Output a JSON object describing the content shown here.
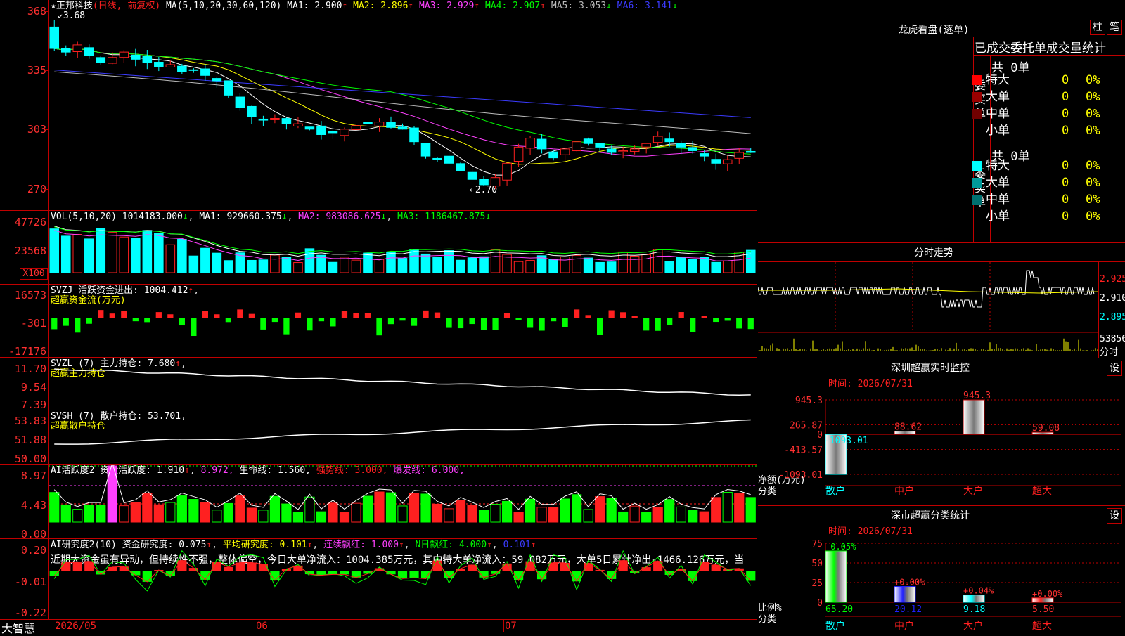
{
  "stock": {
    "name": "正邦科技",
    "mode": "(日线, 前复权)",
    "ma_label": "MA(5,10,20,30,60,120)",
    "ma": [
      {
        "label": "MA1:",
        "value": "2.900",
        "color": "#ffffff"
      },
      {
        "label": "MA2:",
        "value": "2.896",
        "color": "#ffff00"
      },
      {
        "label": "MA3:",
        "value": "2.929",
        "color": "#ff40ff"
      },
      {
        "label": "MA4:",
        "value": "2.907",
        "color": "#00ff00"
      },
      {
        "label": "MA5:",
        "value": "3.053",
        "color": "#bbbbbb"
      },
      {
        "label": "MA6:",
        "value": "3.141",
        "color": "#3b3bff"
      }
    ],
    "high_marker": "3.68",
    "low_marker": "2.70"
  },
  "price_axis": [
    "368",
    "335",
    "303",
    "270"
  ],
  "vol": {
    "label": "VOL(5,10,20)",
    "value": "1014183.000",
    "ma1": "MA1: 929660.375",
    "ma2": "MA2: 983086.625",
    "ma3": "MA3: 1186467.875",
    "axis": [
      "47726",
      "23568"
    ],
    "unit": "X100"
  },
  "svzj": {
    "label": "SVZJ  活跃资金进出: 1004.412",
    "sub": "超赢资金流(万元)",
    "axis": [
      "16573",
      "-301",
      "-17176"
    ]
  },
  "svzl": {
    "label": "SVZL (7) 主力持仓: 7.680",
    "sub": "超赢主力持仓",
    "axis": [
      "11.70",
      "9.54",
      "7.39"
    ]
  },
  "svsh": {
    "label": "SVSH (7) 散户持仓: 53.701",
    "sub": "超赢散户持仓",
    "axis": [
      "53.83",
      "51.88",
      "50.00"
    ]
  },
  "ai_active": {
    "label": "AI活跃度2 资金活跃度: 1.910",
    "v2": "8.972,",
    "life": "生命线: 1.560,",
    "strong": "强势线: 3.000,",
    "burst": "爆发线: 6.000,",
    "axis": [
      "8.97",
      "4.43",
      "0.00"
    ]
  },
  "ai_research": {
    "label": "AI研究度2(10) 资金研究度: 0.075",
    "avg": "平均研究度: 0.101",
    "cont": "连续飘红: 1.000",
    "nday": "N日飘红: 4.000",
    "last": "0.101",
    "comment": "近期大资金虽有异动，但持续性不强，整体偏空，今日大单净流入：1004.385万元，其中特大单净流入：59.082万元，大单5日累计净出-1466.126万元，当",
    "axis": [
      "0.20",
      "-0.01",
      "-0.22"
    ]
  },
  "date_axis": [
    "2026/05",
    "06",
    "07"
  ],
  "logo": "大智慧",
  "dragon": {
    "title": "龙虎看盘(逐单)",
    "btn_zhu": "柱",
    "btn_bi": "笔",
    "header": "已成交委托单成交量统计",
    "buy_total": "共 0单",
    "buy_side": "委买单",
    "sell_total": "共 0单",
    "sell_side": "委卖单",
    "buy_rows": [
      {
        "name": "特大",
        "color": "#ff0000",
        "value": "0",
        "pct": "0%"
      },
      {
        "name": "大单",
        "color": "#9a0000",
        "value": "0",
        "pct": "0%"
      },
      {
        "name": "中单",
        "color": "#700000",
        "value": "0",
        "pct": "0%"
      },
      {
        "name": "小单",
        "color": "#000000",
        "value": "0",
        "pct": "0%"
      }
    ],
    "sell_rows": [
      {
        "name": "特大",
        "color": "#00ffff",
        "value": "0",
        "pct": "0%"
      },
      {
        "name": "大单",
        "color": "#009a9a",
        "value": "0",
        "pct": "0%"
      },
      {
        "name": "中单",
        "color": "#007070",
        "value": "0",
        "pct": "0%"
      },
      {
        "name": "小单",
        "color": "#000000",
        "value": "0",
        "pct": "0%"
      }
    ]
  },
  "intraday": {
    "title": "分时走势",
    "p1": "2.925",
    "p2": "2.910",
    "p3": "2.895",
    "vol": "53856",
    "unit": "分时"
  },
  "monitor": {
    "title": "深圳超赢实时监控",
    "btn": "设",
    "time": "时间: 2026/07/31",
    "ylabel": "净额(万元)",
    "xlabel": "分类",
    "axis": [
      "945.3",
      "265.87",
      "0",
      "-413.57",
      "-1093.01"
    ],
    "cats": [
      "散户",
      "中户",
      "大户",
      "超大"
    ],
    "values": [
      -1093.01,
      88.62,
      945.3,
      59.08
    ],
    "value_labels": [
      "-1093.01",
      "88.62",
      "945.3",
      "59.08"
    ]
  },
  "classify": {
    "title": "深市超赢分类统计",
    "btn": "设",
    "time": "时间: 2026/07/31",
    "ylabel": "比例%",
    "xlabel": "分类",
    "axis": [
      "75",
      "50",
      "25",
      "0"
    ],
    "cats": [
      "散户",
      "中户",
      "大户",
      "超大"
    ],
    "values": [
      65.2,
      20.12,
      9.18,
      5.5
    ],
    "value_labels": [
      "65.20",
      "20.12",
      "9.18",
      "5.50"
    ],
    "changes": [
      "-0.05%",
      "+0.00%",
      "+0.04%",
      "+0.00%"
    ]
  },
  "chart_data": [
    {
      "type": "bar",
      "title": "深圳超赢实时监控",
      "categories": [
        "散户",
        "中户",
        "大户",
        "超大"
      ],
      "values": [
        -1093.01,
        88.62,
        945.3,
        59.08
      ],
      "ylabel": "净额(万元)",
      "xlabel": "分类",
      "ylim": [
        -1093.01,
        945.3
      ]
    },
    {
      "type": "bar",
      "title": "深市超赢分类统计",
      "categories": [
        "散户",
        "中户",
        "大户",
        "超大"
      ],
      "values": [
        65.2,
        20.12,
        9.18,
        5.5
      ],
      "ylabel": "比例%",
      "xlabel": "分类",
      "ylim": [
        0,
        75
      ]
    }
  ]
}
